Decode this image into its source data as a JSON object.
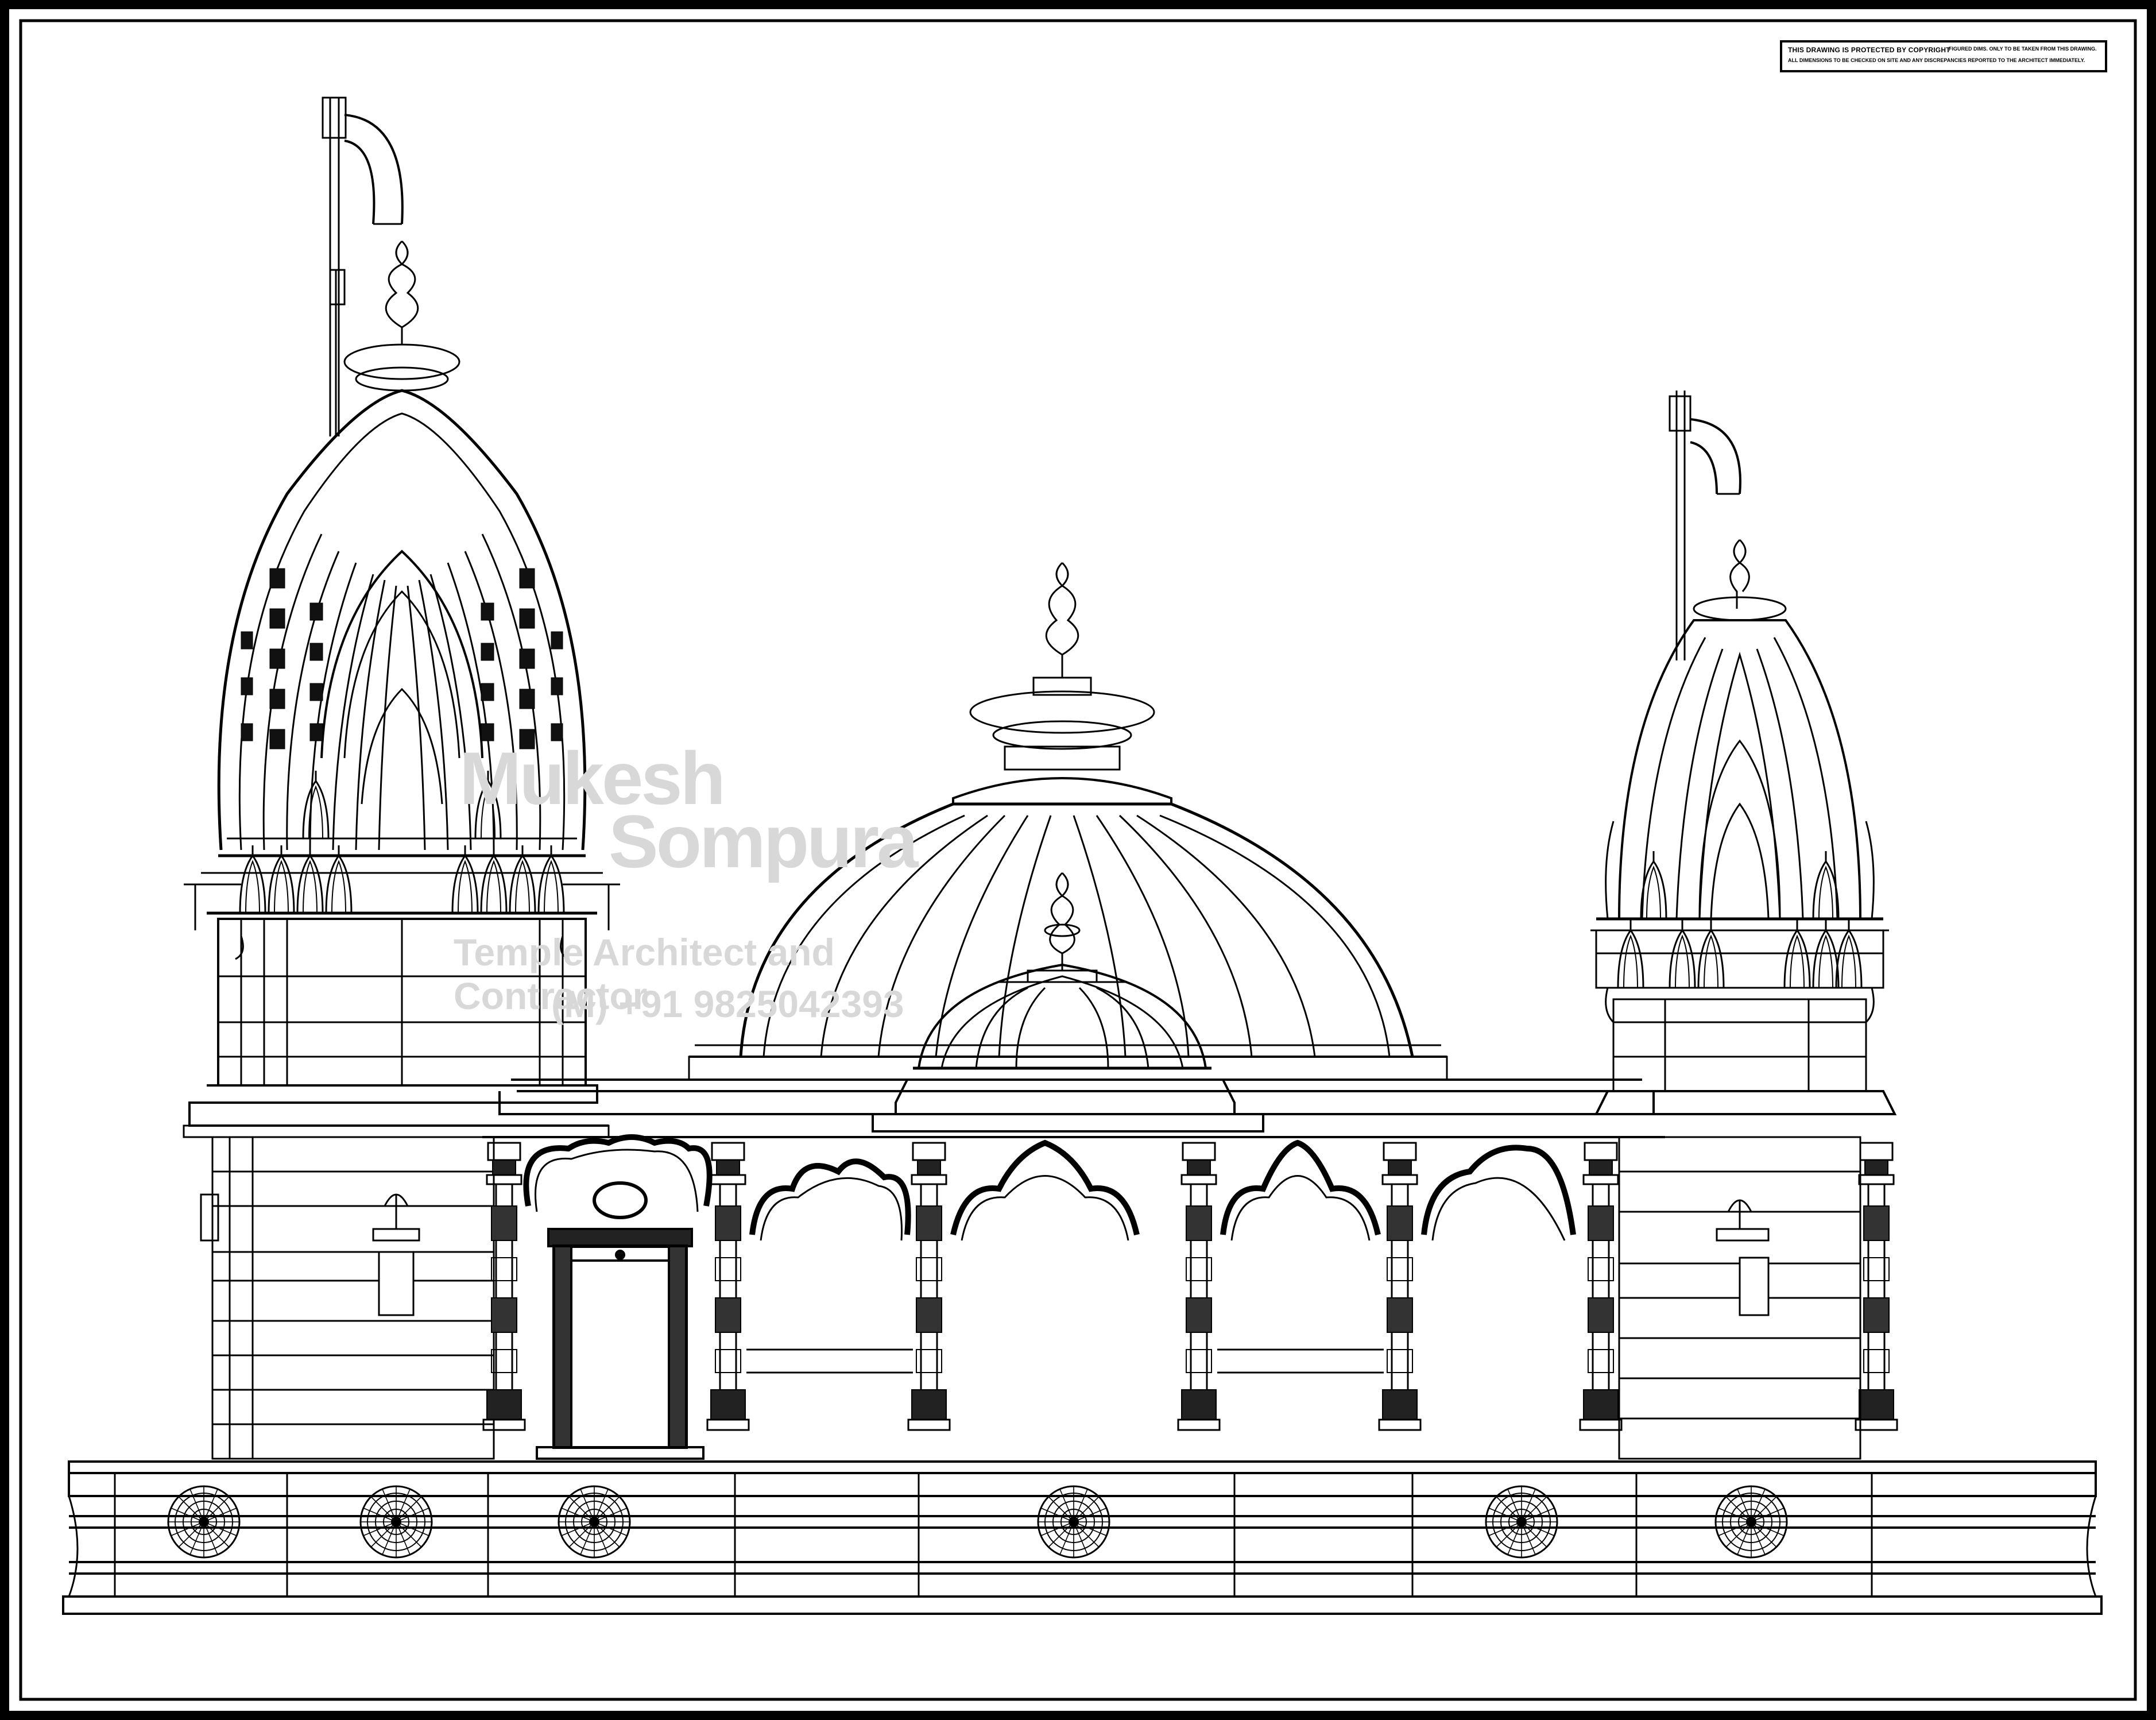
{
  "copyright_note": {
    "line1": "THIS DRAWING IS PROTECTED BY COPYRIGHT",
    "line1b": "FIGURED DIMS. ONLY TO BE TAKEN FROM THIS DRAWING.",
    "line2": "ALL DIMENSIONS TO BE CHECKED ON SITE AND ANY DISCREPANCIES REPORTED TO THE ARCHITECT IMMEDIATELY."
  },
  "watermark": {
    "name_part1": "Mukesh",
    "name_part2": "Sompura",
    "tagline": "Temple Architect and Contractor",
    "phone": "(M) +91 9825042393"
  },
  "icons": {
    "left_flag": "flag-icon",
    "right_flag": "flag-icon",
    "rosette": "rosette-icon"
  },
  "colors": {
    "line": "#000000",
    "background": "#ffffff",
    "watermark": "#d8d8d8"
  }
}
